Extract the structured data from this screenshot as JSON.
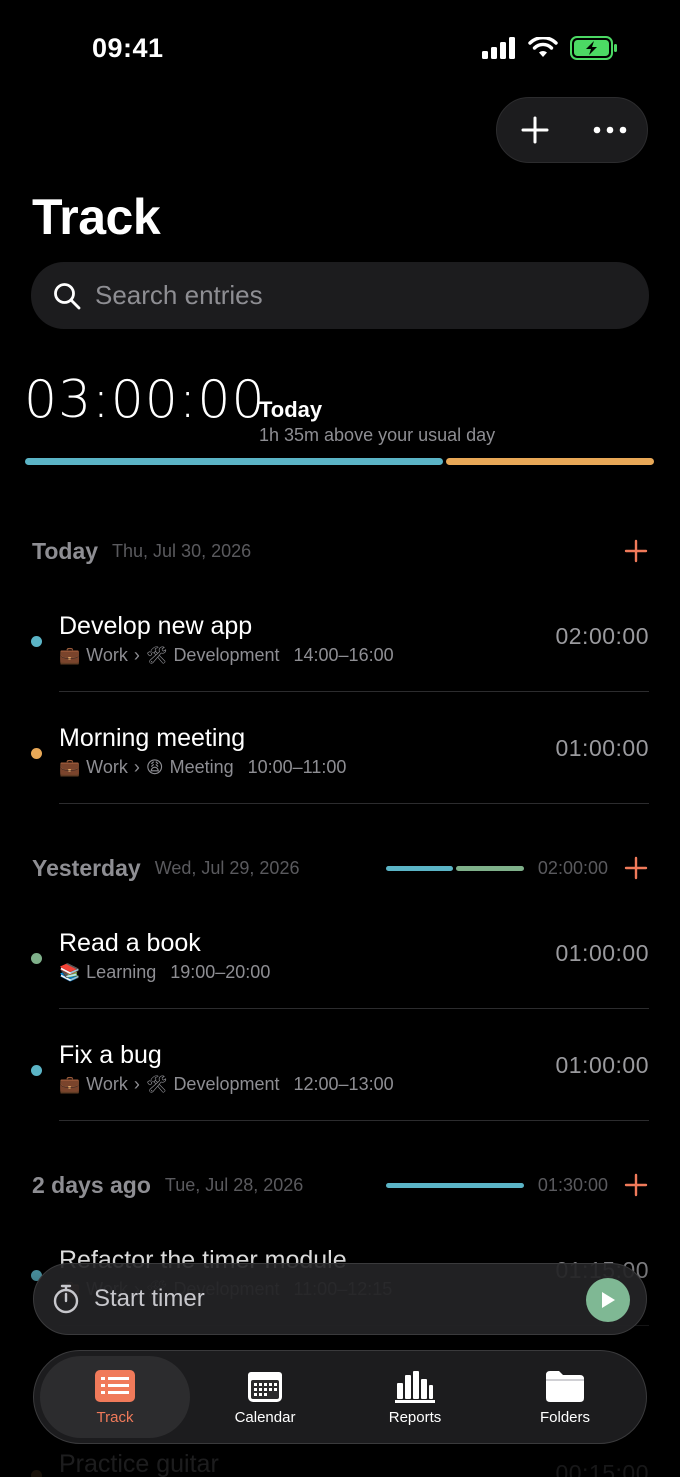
{
  "status": {
    "time": "09:41"
  },
  "page": {
    "title": "Track"
  },
  "search": {
    "placeholder": "Search entries"
  },
  "summary": {
    "total": "03:00:00",
    "label": "Today",
    "sub": "1h 35m above your usual day",
    "progress": [
      {
        "fraction": 0.667,
        "color": "#5bb4c6"
      },
      {
        "fraction": 0.333,
        "color": "#e8a857"
      }
    ]
  },
  "colors": {
    "work": "#5bb4c6",
    "meeting": "#e8a857",
    "learning": "#7fb08a",
    "accent": "#f07a5a"
  },
  "sections": [
    {
      "title": "Today",
      "date": "Thu, Jul 30, 2026",
      "entries": [
        {
          "title": "Develop new app",
          "cat": "Work",
          "cat_emoji": "💼",
          "sub": "Development",
          "sub_emoji": "🛠",
          "range": "14:00–16:00",
          "duration": "02:00:00",
          "dot": "#5bb4c6"
        },
        {
          "title": "Morning meeting",
          "cat": "Work",
          "cat_emoji": "💼",
          "sub": "Meeting",
          "sub_emoji": "😩",
          "range": "10:00–11:00",
          "duration": "01:00:00",
          "dot": "#e8a857"
        }
      ]
    },
    {
      "title": "Yesterday",
      "date": "Wed, Jul 29, 2026",
      "total": "02:00:00",
      "bar": [
        {
          "fraction": 0.5,
          "color": "#5bb4c6"
        },
        {
          "fraction": 0.5,
          "color": "#7fb08a"
        }
      ],
      "entries": [
        {
          "title": "Read a book",
          "cat": "Learning",
          "cat_emoji": "📚",
          "range": "19:00–20:00",
          "duration": "01:00:00",
          "dot": "#7fb08a"
        },
        {
          "title": "Fix a bug",
          "cat": "Work",
          "cat_emoji": "💼",
          "sub": "Development",
          "sub_emoji": "🛠",
          "range": "12:00–13:00",
          "duration": "01:00:00",
          "dot": "#5bb4c6"
        }
      ]
    },
    {
      "title": "2 days ago",
      "date": "Tue, Jul 28, 2026",
      "total": "01:30:00",
      "bar": [
        {
          "fraction": 1,
          "color": "#5bb4c6"
        }
      ],
      "entries": [
        {
          "title": "Refactor the timer module",
          "cat": "Work",
          "cat_emoji": "💼",
          "sub": "Development",
          "sub_emoji": "🛠",
          "range": "11:00–12:15",
          "duration": "01:15:00",
          "dot": "#5bb4c6"
        }
      ]
    }
  ],
  "partial_entry": {
    "title": "Practice guitar",
    "duration": "00:15:00"
  },
  "timer": {
    "label": "Start timer"
  },
  "tabs": [
    {
      "label": "Track",
      "icon": "list-icon",
      "active": true
    },
    {
      "label": "Calendar",
      "icon": "calendar-icon",
      "active": false
    },
    {
      "label": "Reports",
      "icon": "bar-chart-icon",
      "active": false
    },
    {
      "label": "Folders",
      "icon": "folder-icon",
      "active": false
    }
  ]
}
